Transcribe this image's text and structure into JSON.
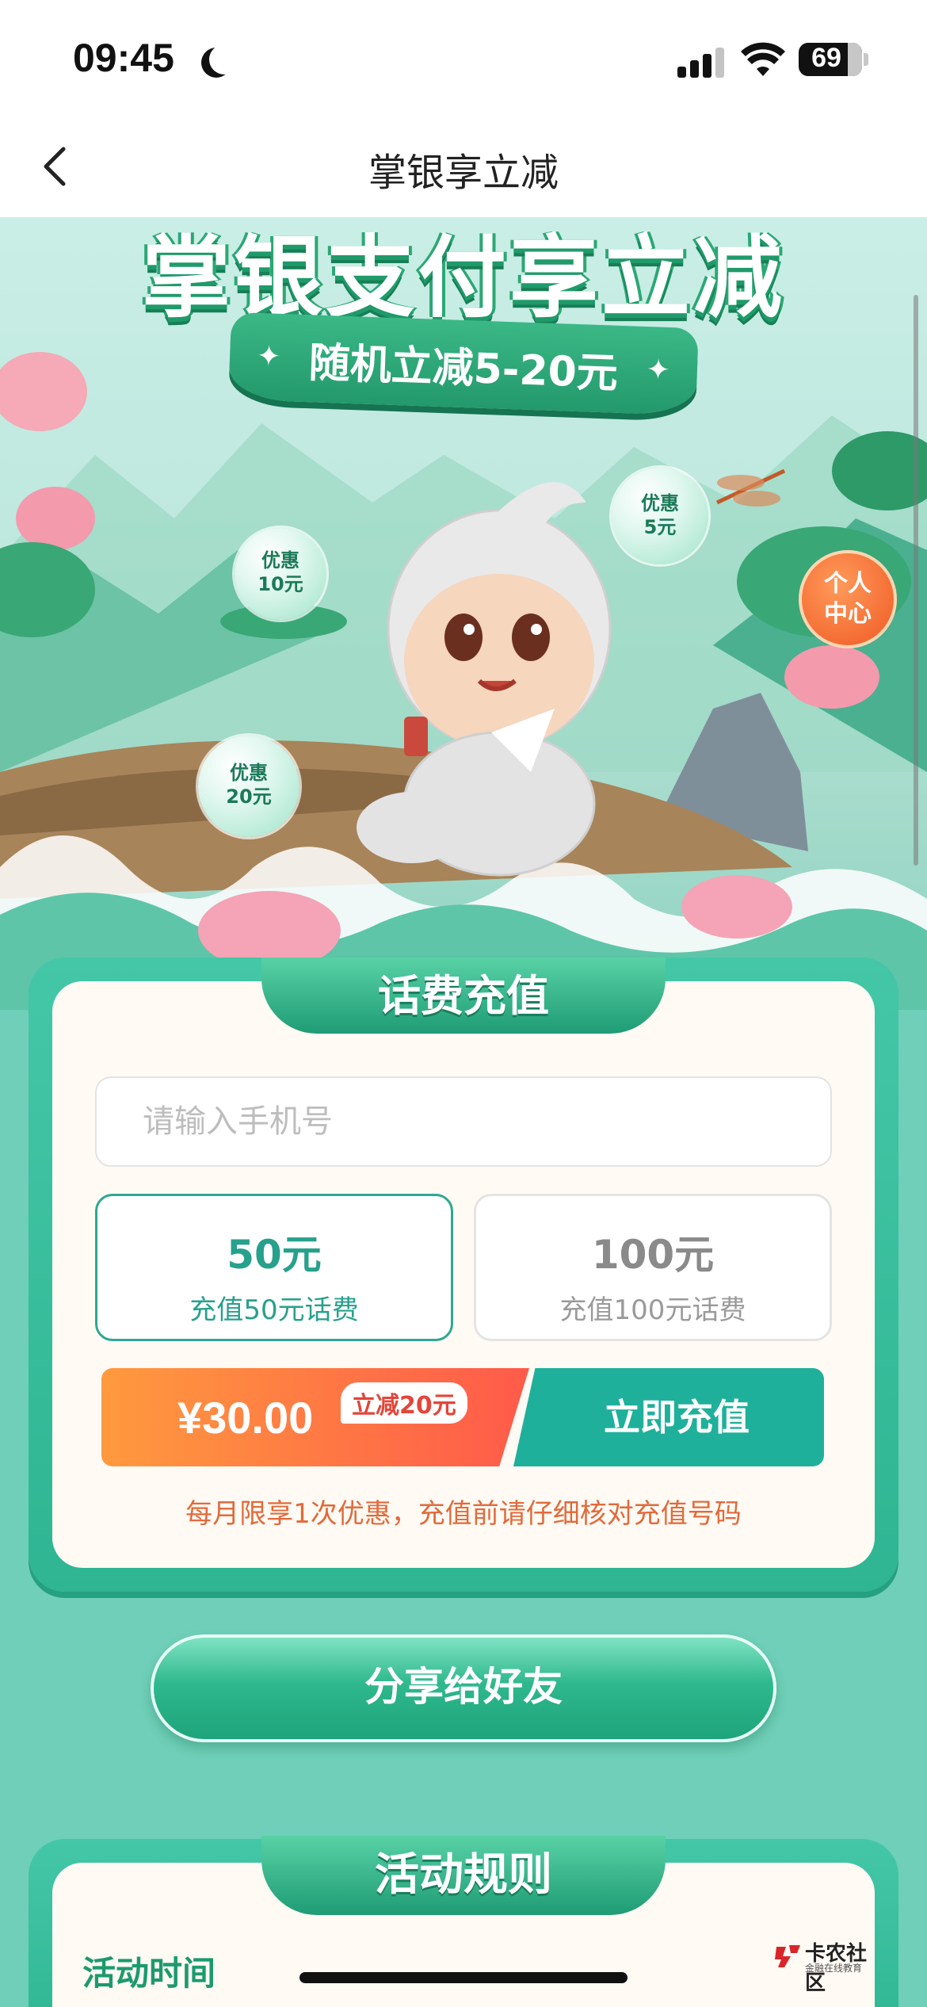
{
  "status_bar": {
    "time": "09:45",
    "battery": "69",
    "icons": [
      "moon-icon",
      "signal-icon",
      "wifi-icon",
      "battery-icon"
    ]
  },
  "nav": {
    "title": "掌银享立减",
    "back_icon": "chevron-left-icon"
  },
  "hero": {
    "title": "掌银支付享立减",
    "ribbon": "随机立减5-20元",
    "bubbles": [
      {
        "line1": "优惠",
        "line2": "10元"
      },
      {
        "line1": "优惠",
        "line2": "5元"
      },
      {
        "line1": "优惠",
        "line2": "20元"
      }
    ],
    "personal_center": {
      "line1": "个人",
      "line2": "中心"
    }
  },
  "recharge": {
    "title": "话费充值",
    "phone_placeholder": "请输入手机号",
    "phone_value": "",
    "options": [
      {
        "amount": "50元",
        "desc": "充值50元话费",
        "selected": true
      },
      {
        "amount": "100元",
        "desc": "充值100元话费",
        "selected": false
      }
    ],
    "price": "¥30.00",
    "discount_badge": "立减20元",
    "pay_button": "立即充值",
    "notice": "每月限享1次优惠，充值前请仔细核对充值号码"
  },
  "share_button": "分享给好友",
  "rules": {
    "title": "活动规则",
    "time_label": "活动时间"
  },
  "watermark": {
    "main": "卡农社区",
    "sub": "金融在线教育"
  },
  "colors": {
    "accent_green": "#1fb09b",
    "primary_teal": "#2fb592",
    "orange": "#ff5a4a",
    "page_bg": "#6fcfb8"
  }
}
